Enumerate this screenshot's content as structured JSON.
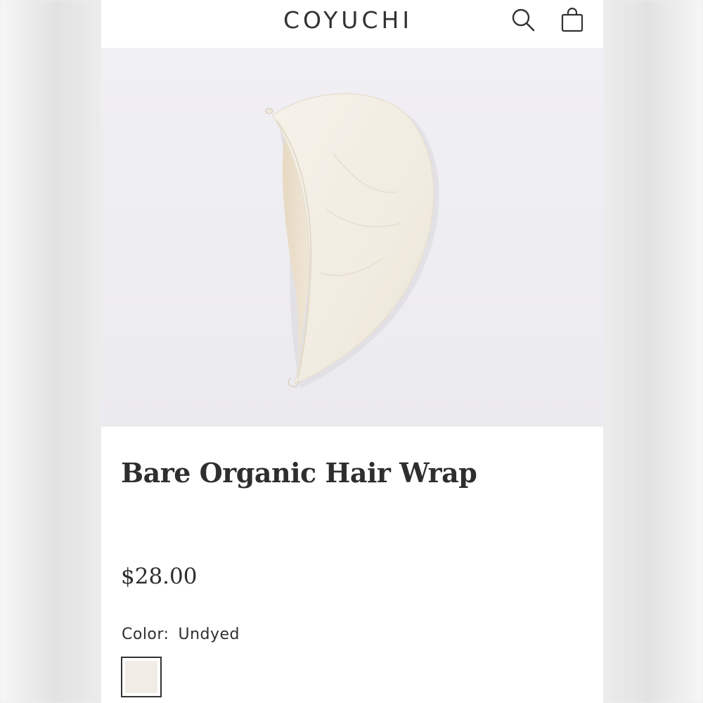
{
  "header": {
    "brand": "COYUCHI",
    "search_icon": "search-icon",
    "cart_icon": "shopping-bag-icon"
  },
  "product": {
    "image_subject": "hair-wrap-product-photo",
    "title": "Bare Organic Hair Wrap",
    "price": "$28.00",
    "color_label": "Color:",
    "color_value": "Undyed",
    "swatches": [
      {
        "name": "Undyed",
        "color": "#f1ede6",
        "selected": true
      }
    ]
  },
  "colors": {
    "text": "#2e2e2e",
    "image_bg": "#eeedf1",
    "fabric": "#f3eee4"
  }
}
